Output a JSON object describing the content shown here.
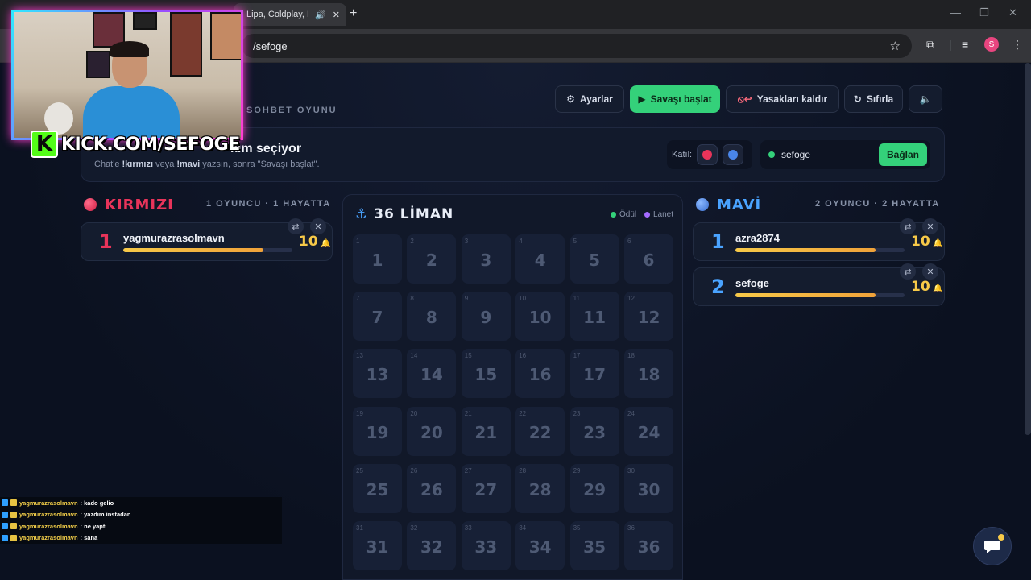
{
  "browser": {
    "tab_title": "Lipa, Coldplay, M",
    "url": "/sefoge",
    "profile_initial": "S"
  },
  "app": {
    "subtitle": "SOHBET OYUNU",
    "buttons": {
      "settings": "Ayarlar",
      "start": "Savaşı başlat",
      "unban": "Yasakları kaldır",
      "reset": "Sıfırla"
    },
    "info": {
      "title": "kım seçiyor",
      "desc_prefix": "Chat'e ",
      "cmd_red": "!kırmızı",
      "desc_mid": " veya ",
      "cmd_blue": "!mavi",
      "desc_suffix": " yazsın, sonra \"Savaşı başlat\"."
    },
    "join_label": "Katıl:",
    "channel": "sefoge",
    "connect_label": "Bağlan"
  },
  "teams": {
    "red": {
      "name": "KIRMIZI",
      "stats": "1 OYUNCU · 1 HAYATTA",
      "color": "#e8345a",
      "players": [
        {
          "rank": "1",
          "name": "yagmurazrasolmavn",
          "lives": "10",
          "progress": 0.83
        }
      ]
    },
    "blue": {
      "name": "MAVİ",
      "stats": "2 OYUNCU · 2 HAYATTA",
      "color": "#4aa3ff",
      "players": [
        {
          "rank": "1",
          "name": "azra2874",
          "lives": "10",
          "progress": 0.83
        },
        {
          "rank": "2",
          "name": "sefoge",
          "lives": "10",
          "progress": 0.83
        }
      ]
    }
  },
  "board": {
    "title": "36 LİMAN",
    "legend_reward": "Ödül",
    "legend_curse": "Lanet",
    "reward_color": "#34d17a",
    "curse_color": "#a56bff",
    "cells": [
      "1",
      "2",
      "3",
      "4",
      "5",
      "6",
      "7",
      "8",
      "9",
      "10",
      "11",
      "12",
      "13",
      "14",
      "15",
      "16",
      "17",
      "18",
      "19",
      "20",
      "21",
      "22",
      "23",
      "24",
      "25",
      "26",
      "27",
      "28",
      "29",
      "30",
      "31",
      "32",
      "33",
      "34",
      "35",
      "36"
    ]
  },
  "stream": {
    "kick_url": "KICK.COM/SEFOGE",
    "chat": [
      {
        "user": "yagmurazrasolmavn",
        "text": " : kado gelio"
      },
      {
        "user": "yagmurazrasolmavn",
        "text": " : yazdım instadan"
      },
      {
        "user": "yagmurazrasolmavn",
        "text": " : ne yaptı"
      },
      {
        "user": "yagmurazrasolmavn",
        "text": " : sana"
      }
    ]
  }
}
